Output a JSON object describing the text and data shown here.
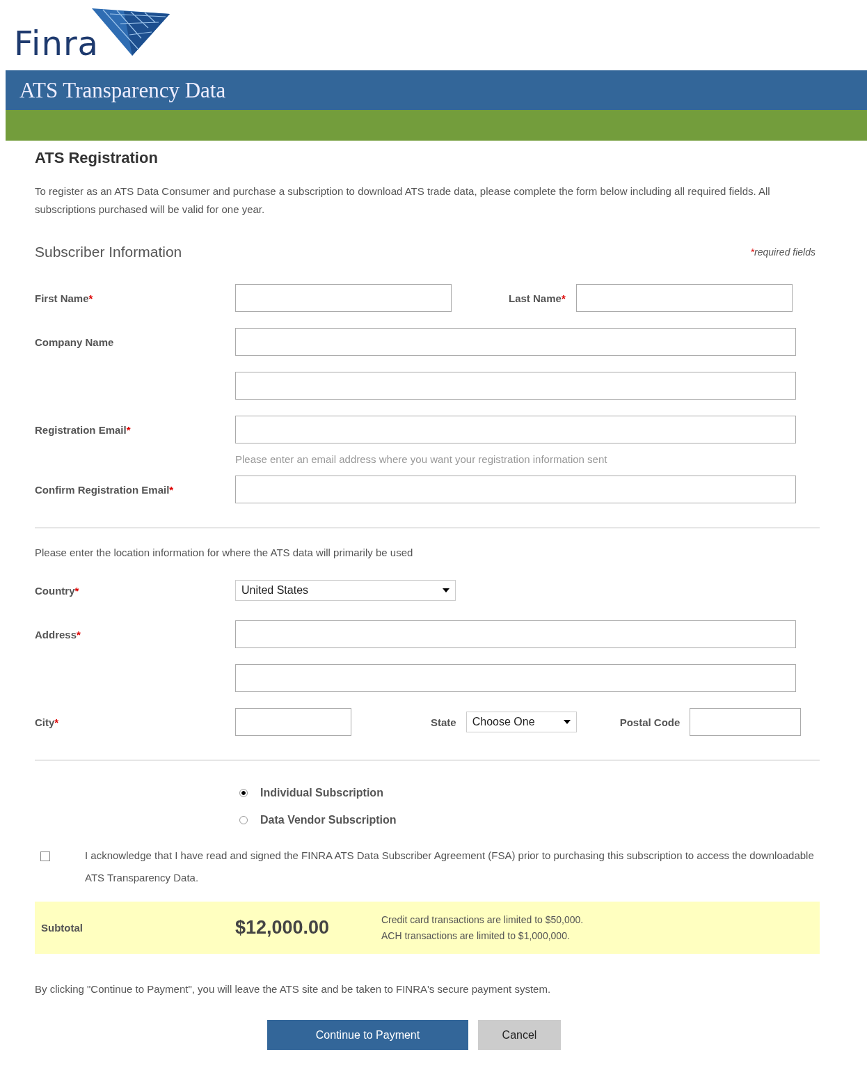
{
  "logo": {
    "text": "Finra"
  },
  "banner": {
    "title": "ATS Transparency Data"
  },
  "page": {
    "title": "ATS Registration",
    "intro": "To register as an ATS Data Consumer and purchase a subscription to download ATS trade data, please complete the form below including all required fields. All subscriptions purchased will be valid for one year."
  },
  "subscriber": {
    "heading": "Subscriber Information",
    "required_note": {
      "mark": "*",
      "text": "required fields"
    },
    "rows": [
      {
        "kind": "pair",
        "fields": [
          {
            "label": "First Name",
            "mark": "*"
          },
          {
            "label": "Last Name",
            "mark": "*"
          }
        ]
      },
      {
        "kind": "double",
        "label": "Company Name"
      },
      {
        "kind": "single",
        "label": "Registration Email",
        "mark": "*",
        "hint": "Please enter an email address where you want your registration information sent"
      },
      {
        "kind": "single",
        "label": "Confirm Registration Email",
        "mark": "*"
      }
    ]
  },
  "location": {
    "note": "Please enter the location information for where the ATS data will primarily be used",
    "rows": [
      {
        "kind": "select",
        "label": "Country",
        "mark": "*",
        "value": "United States"
      },
      {
        "kind": "double",
        "label": "Address",
        "mark": "*"
      },
      {
        "kind": "city",
        "label": "City",
        "mark": "*",
        "state_label": "State",
        "state_value": "Choose One",
        "postal_label": "Postal Code"
      }
    ]
  },
  "subscription_options": [
    {
      "label": "Individual Subscription",
      "selected": true
    },
    {
      "label": "Data Vendor Subscription",
      "selected": false
    }
  ],
  "acknowledgement": {
    "checked": false,
    "text": "I acknowledge that I have read and signed the FINRA ATS Data Subscriber Agreement (FSA) prior to purchasing this subscription to access the downloadable ATS Transparency Data."
  },
  "subtotal": {
    "label": "Subtotal",
    "amount": "$12,000.00",
    "notes": [
      "Credit card transactions are limited to $50,000.",
      "ACH transactions are limited to $1,000,000."
    ]
  },
  "notice": "By clicking \"Continue to Payment\", you will leave the ATS site and be taken to FINRA's secure payment system.",
  "buttons": [
    {
      "label": "Continue to Payment",
      "kind": "primary"
    },
    {
      "label": "Cancel",
      "kind": "secondary"
    }
  ]
}
